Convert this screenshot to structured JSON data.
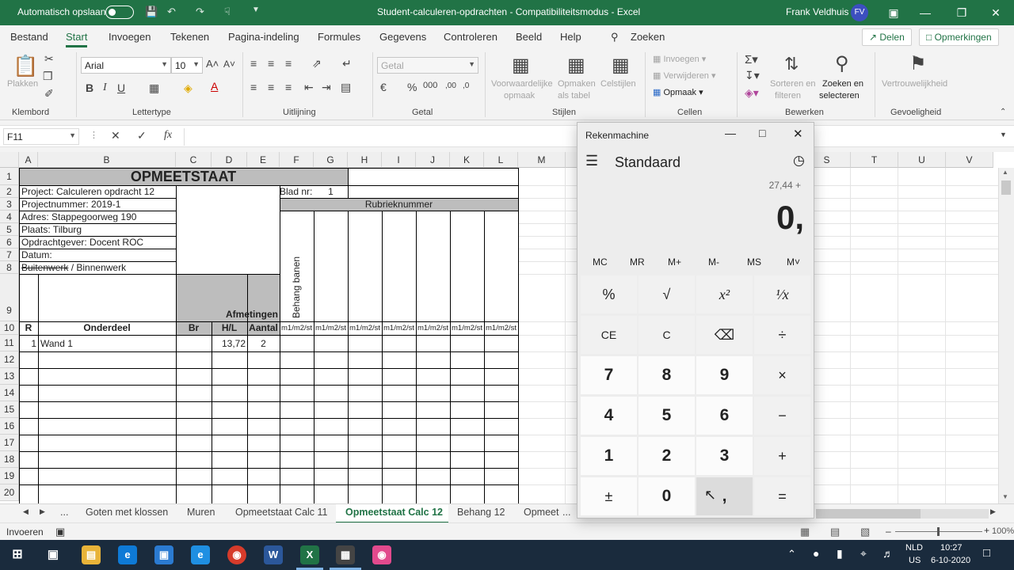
{
  "titlebar": {
    "autosave_label": "Automatisch opslaan",
    "document_title": "Student-calculeren-opdrachten  -  Compatibiliteitsmodus  -  Excel",
    "user_name": "Frank Veldhuis",
    "user_initials": "FV",
    "accent": "#217346"
  },
  "ribbon_tabs": [
    "Bestand",
    "Start",
    "Invoegen",
    "Tekenen",
    "Pagina-indeling",
    "Formules",
    "Gegevens",
    "Controleren",
    "Beeld",
    "Help",
    "Zoeken"
  ],
  "share_label": "Delen",
  "comments_label": "Opmerkingen",
  "ribbon": {
    "paste_label": "Plakken",
    "clipboard_group": "Klembord",
    "font_name": "Arial",
    "font_size": "10",
    "font_group": "Lettertype",
    "align_group": "Uitlijning",
    "number_format": "Getal",
    "number_group": "Getal",
    "cond_format": "Voorwaardelijke",
    "cond_format2": "opmaak",
    "format_table": "Opmaken",
    "format_table2": "als tabel",
    "cell_styles": "Celstijlen",
    "styles_group": "Stijlen",
    "insert_label": "Invoegen",
    "delete_label": "Verwijderen",
    "format_label": "Opmaak",
    "cells_group": "Cellen",
    "sort_label": "Sorteren en",
    "sort_label2": "filteren",
    "find_label": "Zoeken en",
    "find_label2": "selecteren",
    "edit_group": "Bewerken",
    "sensitivity_label": "Vertrouwelijkheid",
    "sensitivity_group": "Gevoeligheid"
  },
  "formula_bar": {
    "name_box": "F11",
    "formula": ""
  },
  "columns": [
    "A",
    "B",
    "C",
    "D",
    "E",
    "F",
    "G",
    "H",
    "I",
    "J",
    "K",
    "L",
    "M",
    "S",
    "T",
    "U",
    "V"
  ],
  "rows": [
    "1",
    "2",
    "3",
    "4",
    "5",
    "6",
    "7",
    "8",
    "9",
    "10",
    "11",
    "12",
    "13",
    "14",
    "15",
    "16",
    "17",
    "18",
    "19",
    "20"
  ],
  "sheet": {
    "title": "OPMEETSTAAT",
    "project": "Project: Calculeren opdracht 12",
    "projectnummer": "Projectnummer: 2019-1",
    "adres": "Adres: Stappegoorweg 190",
    "plaats": "Plaats: Tilburg",
    "opdrachtgever": "Opdrachtgever: Docent ROC",
    "datum": "Datum:",
    "buitenwerk": "Buitenwerk",
    "slash": " /  Binnenwerk",
    "blad_label": "Blad nr:",
    "blad_value": "1",
    "rubrieknummer": "Rubrieknummer",
    "behang": "Behang banen",
    "afmetingen": "Afmetingen",
    "hdr_r": "R",
    "hdr_onderdeel": "Onderdeel",
    "hdr_br": "Br",
    "hdr_hl": "H/L",
    "hdr_aantal": "Aantal",
    "unit": "m1/m2/st",
    "row11_r": "1",
    "row11_onderdeel": "Wand 1",
    "row11_hl": "13,72",
    "row11_aantal": "2"
  },
  "sheet_tabs": [
    "...",
    "Goten met klossen",
    "Muren",
    "Opmeetstaat Calc 11",
    "Opmeetstaat Calc 12",
    "Behang 12",
    "Opmeet",
    "..."
  ],
  "status": {
    "mode": "Invoeren",
    "zoom": "100%"
  },
  "taskbar": {
    "lang": "NLD",
    "layout": "US",
    "time": "10:27",
    "date": "6-10-2020"
  },
  "calculator": {
    "window_title": "Rekenmachine",
    "mode": "Standaard",
    "expression": "27,44 +",
    "display": "0,",
    "memory": [
      "MC",
      "MR",
      "M+",
      "M-",
      "MS",
      "M˅"
    ],
    "keys": [
      [
        "%",
        "√",
        "x²",
        "¹⁄x"
      ],
      [
        "CE",
        "C",
        "⌫",
        "÷"
      ],
      [
        "7",
        "8",
        "9",
        "×"
      ],
      [
        "4",
        "5",
        "6",
        "−"
      ],
      [
        "1",
        "2",
        "3",
        "+"
      ],
      [
        "±",
        "0",
        ",",
        "="
      ]
    ]
  }
}
